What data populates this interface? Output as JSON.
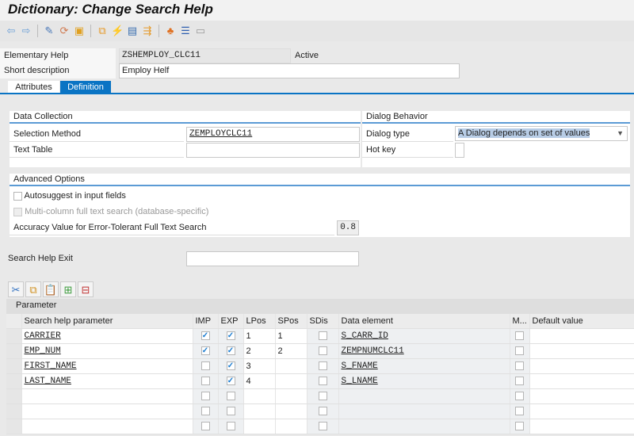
{
  "title": "Dictionary: Change Search Help",
  "toolbar": [
    "back-icon",
    "forward-icon",
    "display-change-icon",
    "active-inactive-icon",
    "other-object-icon",
    "check-icon",
    "activate-icon",
    "where-used-icon",
    "test-icon",
    "hierarchy-icon",
    "navigation-stack-icon",
    "layout-icon"
  ],
  "header": {
    "elementary_help_label": "Elementary Help",
    "elementary_help_value": "ZSHEMPLOY_CLC11",
    "status": "Active",
    "short_desc_label": "Short description",
    "short_desc_value": "Employ Helf"
  },
  "tabs": [
    {
      "label": "Attributes"
    },
    {
      "label": "Definition"
    }
  ],
  "data_collection": {
    "title": "Data Collection",
    "selection_method_label": "Selection Method",
    "selection_method_value": "ZEMPLOYCLC11",
    "text_table_label": "Text Table",
    "text_table_value": ""
  },
  "dialog_behavior": {
    "title": "Dialog Behavior",
    "dialog_type_label": "Dialog type",
    "dialog_type_value": "A Dialog depends on set of values",
    "hot_key_label": "Hot key",
    "hot_key_value": ""
  },
  "advanced": {
    "title": "Advanced Options",
    "autosuggest": "Autosuggest in input fields",
    "multicolumn": "Multi-column full text search (database-specific)",
    "accuracy_label": "Accuracy Value for Error-Tolerant Full Text Search",
    "accuracy_value": "0.8"
  },
  "exit": {
    "label": "Search Help Exit",
    "value": ""
  },
  "table": {
    "toolbar": [
      "cut-icon",
      "copy-icon",
      "paste-icon",
      "insert-row-icon",
      "delete-row-icon"
    ],
    "title": "Parameter",
    "headers": [
      "Search help parameter",
      "IMP",
      "EXP",
      "LPos",
      "SPos",
      "SDis",
      "Data element",
      "M...",
      "Default value"
    ],
    "rows": [
      {
        "param": "CARRIER",
        "imp": true,
        "exp": true,
        "lpos": "1",
        "spos": "1",
        "sdis": false,
        "element": "S_CARR_ID",
        "m": false,
        "default": ""
      },
      {
        "param": "EMP_NUM",
        "imp": true,
        "exp": true,
        "lpos": "2",
        "spos": "2",
        "sdis": false,
        "element": "ZEMPNUMCLC11",
        "m": false,
        "default": ""
      },
      {
        "param": "FIRST_NAME",
        "imp": false,
        "exp": true,
        "lpos": "3",
        "spos": "",
        "sdis": false,
        "element": "S_FNAME",
        "m": false,
        "default": ""
      },
      {
        "param": "LAST_NAME",
        "imp": false,
        "exp": true,
        "lpos": "4",
        "spos": "",
        "sdis": false,
        "element": "S_LNAME",
        "m": false,
        "default": ""
      },
      {
        "param": "",
        "imp": false,
        "exp": false,
        "lpos": "",
        "spos": "",
        "sdis": false,
        "element": "",
        "m": false,
        "default": ""
      },
      {
        "param": "",
        "imp": false,
        "exp": false,
        "lpos": "",
        "spos": "",
        "sdis": false,
        "element": "",
        "m": false,
        "default": ""
      },
      {
        "param": "",
        "imp": false,
        "exp": false,
        "lpos": "",
        "spos": "",
        "sdis": false,
        "element": "",
        "m": false,
        "default": ""
      }
    ]
  }
}
